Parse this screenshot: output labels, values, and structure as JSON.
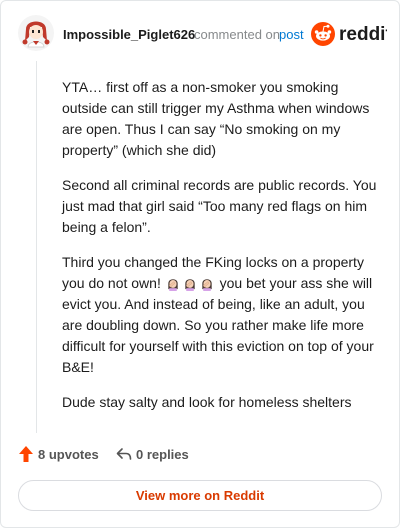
{
  "comment": {
    "username": "Impossible_Piglet626",
    "action_text": "commented on",
    "post_link": "post",
    "paragraphs": {
      "p1": "YTA… first off as a non-smoker you smoking outside can still trigger my Asthma when windows are open. Thus I can say “No smoking on my property” (which she did)",
      "p2": "Second all criminal records are public records. You just mad that girl said “Too many red flags on him being a felon”.",
      "p3_before": "Third you changed the FKing locks on a property you do not own!",
      "p3_emoji": [
        "woman-facepalming-emoji",
        "woman-facepalming-emoji",
        "woman-facepalming-emoji"
      ],
      "p3_after": " you bet your ass she will evict you. And instead of being, like an adult, you are doubling down. So you rather make life more difficult for yourself with this eviction on top of your B&E!",
      "p4": "Dude stay salty and look for homeless shelters"
    },
    "upvotes": "8 upvotes",
    "replies": "0 replies"
  },
  "brand": {
    "logo_text": "reddit",
    "accent_color": "#ff4500"
  },
  "actions": {
    "view_more": "View more on Reddit"
  }
}
